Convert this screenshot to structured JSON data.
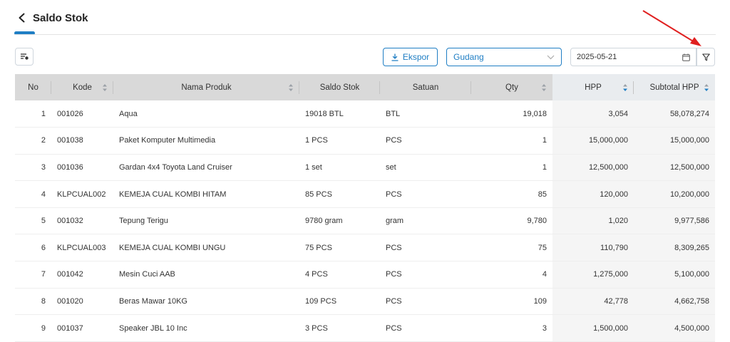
{
  "header": {
    "title": "Saldo Stok"
  },
  "toolbar": {
    "export_label": "Ekspor",
    "warehouse_value": "Gudang",
    "date_value": "2025-05-21"
  },
  "table": {
    "headers": {
      "no": "No",
      "kode": "Kode",
      "nama": "Nama Produk",
      "saldo": "Saldo Stok",
      "satuan": "Satuan",
      "qty": "Qty",
      "hpp": "HPP",
      "subtotal": "Subtotal HPP"
    },
    "rows": [
      {
        "no": "1",
        "kode": "001026",
        "nama": "Aqua",
        "saldo": "19018 BTL",
        "satuan": "BTL",
        "qty": "19,018",
        "hpp": "3,054",
        "subtotal": "58,078,274"
      },
      {
        "no": "2",
        "kode": "001038",
        "nama": "Paket Komputer Multimedia",
        "saldo": "1 PCS",
        "satuan": "PCS",
        "qty": "1",
        "hpp": "15,000,000",
        "subtotal": "15,000,000"
      },
      {
        "no": "3",
        "kode": "001036",
        "nama": "Gardan 4x4 Toyota Land Cruiser",
        "saldo": "1 set",
        "satuan": "set",
        "qty": "1",
        "hpp": "12,500,000",
        "subtotal": "12,500,000"
      },
      {
        "no": "4",
        "kode": "KLPCUAL002",
        "nama": "KEMEJA CUAL KOMBI HITAM",
        "saldo": "85 PCS",
        "satuan": "PCS",
        "qty": "85",
        "hpp": "120,000",
        "subtotal": "10,200,000"
      },
      {
        "no": "5",
        "kode": "001032",
        "nama": "Tepung Terigu",
        "saldo": "9780 gram",
        "satuan": "gram",
        "qty": "9,780",
        "hpp": "1,020",
        "subtotal": "9,977,586"
      },
      {
        "no": "6",
        "kode": "KLPCUAL003",
        "nama": "KEMEJA CUAL KOMBI UNGU",
        "saldo": "75 PCS",
        "satuan": "PCS",
        "qty": "75",
        "hpp": "110,790",
        "subtotal": "8,309,265"
      },
      {
        "no": "7",
        "kode": "001042",
        "nama": "Mesin Cuci AAB",
        "saldo": "4 PCS",
        "satuan": "PCS",
        "qty": "4",
        "hpp": "1,275,000",
        "subtotal": "5,100,000"
      },
      {
        "no": "8",
        "kode": "001020",
        "nama": "Beras Mawar 10KG",
        "saldo": "109 PCS",
        "satuan": "PCS",
        "qty": "109",
        "hpp": "42,778",
        "subtotal": "4,662,758"
      },
      {
        "no": "9",
        "kode": "001037",
        "nama": "Speaker JBL 10 Inc",
        "saldo": "3 PCS",
        "satuan": "PCS",
        "qty": "3",
        "hpp": "1,500,000",
        "subtotal": "4,500,000"
      }
    ]
  },
  "colors": {
    "accent": "#1f7ec4",
    "header_bg": "#d9d9d9",
    "annotation_arrow": "#e02020"
  },
  "icons": {
    "back": "chevron-left-icon",
    "column_settings": "column-settings-icon",
    "export": "download-icon",
    "dropdown": "chevron-down-icon",
    "calendar": "calendar-icon",
    "filter": "funnel-icon",
    "sort": "sort-icon",
    "annotation": "red-arrow-icon"
  }
}
